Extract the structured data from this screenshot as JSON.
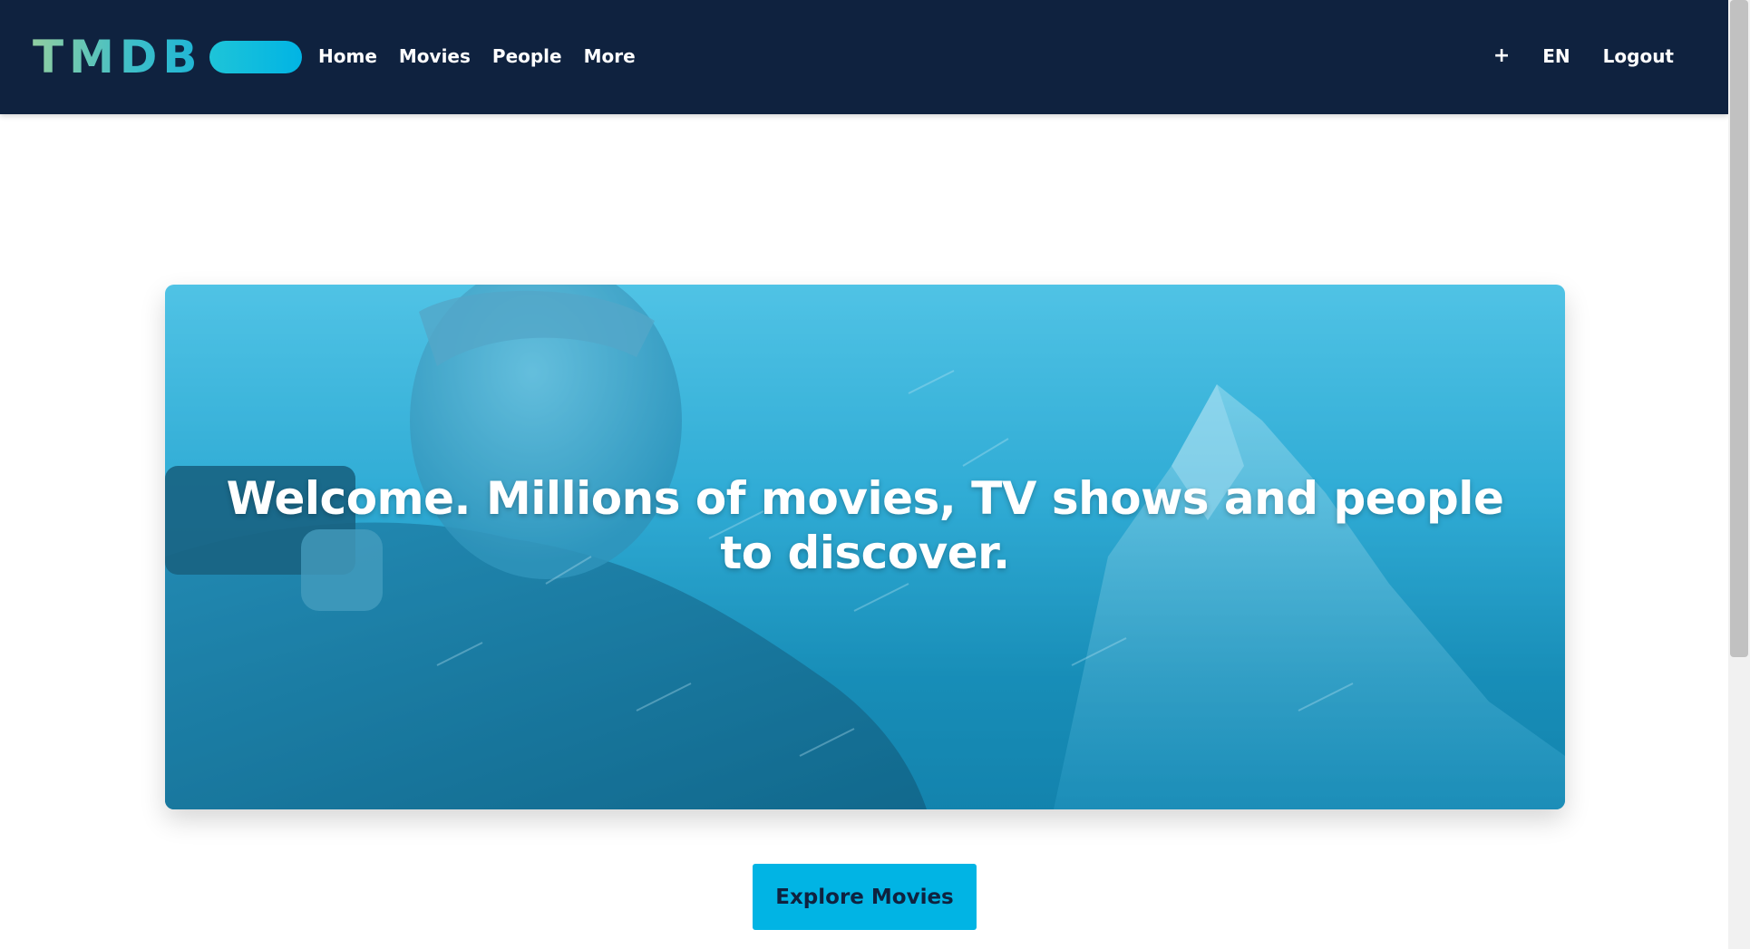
{
  "header": {
    "logo_text": "TMDB",
    "nav": [
      {
        "label": "Home"
      },
      {
        "label": "Movies"
      },
      {
        "label": "People"
      },
      {
        "label": "More"
      }
    ],
    "add_label": "+",
    "language_label": "EN",
    "logout_label": "Logout"
  },
  "hero": {
    "title": "Welcome. Millions of movies, TV shows and people to discover."
  },
  "cta": {
    "label": "Explore Movies"
  },
  "colors": {
    "header_bg": "#0f223f",
    "accent": "#01b4e4",
    "logo_green": "#90cea1"
  }
}
